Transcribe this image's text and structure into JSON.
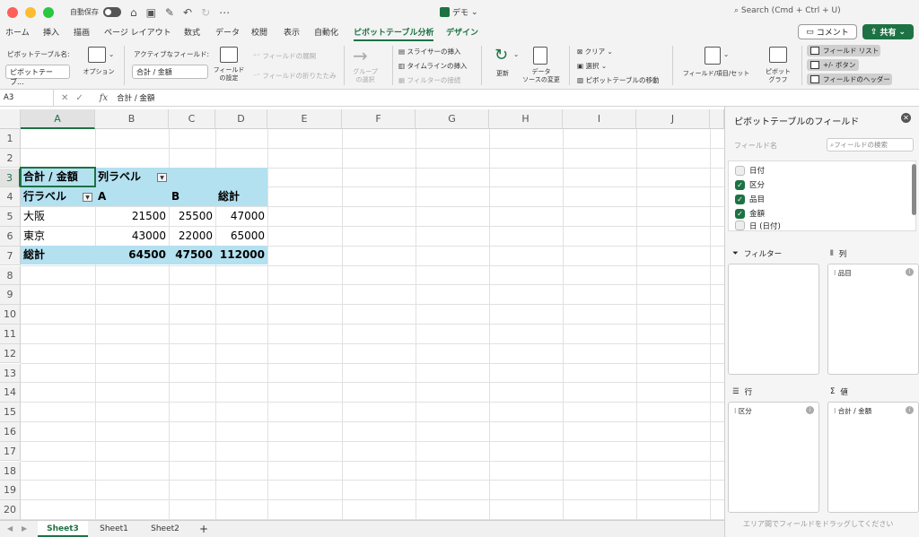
{
  "titlebar": {
    "autosave_label": "自動保存",
    "doc_title": "デモ",
    "search_placeholder": "Search (Cmd + Ctrl + U)"
  },
  "tabs": [
    {
      "label": "ホーム"
    },
    {
      "label": "挿入"
    },
    {
      "label": "描画"
    },
    {
      "label": "ページ レイアウト"
    },
    {
      "label": "数式"
    },
    {
      "label": "データ"
    },
    {
      "label": "校閲"
    },
    {
      "label": "表示"
    },
    {
      "label": "自動化"
    },
    {
      "label": "ピボットテーブル分析"
    },
    {
      "label": "デザイン"
    }
  ],
  "actions": {
    "comment": "コメント",
    "share": "共有"
  },
  "ribbon": {
    "pivot_name_label": "ピボットテーブル名:",
    "pivot_name_value": "ピボットテーブ...",
    "options": "オプション",
    "active_field_label": "アクティブなフィールド:",
    "active_field_value": "合計 / 金額",
    "field_settings_1": "フィールド",
    "field_settings_2": "の設定",
    "expand_field": "フィールドの展開",
    "collapse_field": "フィールドの折りたたみ",
    "group_1": "グループ",
    "group_2": "の選択",
    "insert_slicer": "スライサーの挿入",
    "insert_timeline": "タイムラインの挿入",
    "filter_connection": "フィルターの接続",
    "refresh": "更新",
    "datasource_1": "データ",
    "datasource_2": "ソースの変更",
    "clear": "クリア",
    "select": "選択",
    "move_pivot": "ピボットテーブルの移動",
    "fields_items": "フィールド/項目/セット",
    "pivot_chart_1": "ピボット",
    "pivot_chart_2": "グラフ",
    "field_list": "フィールド リスト",
    "plusminus": "+/- ボタン",
    "field_headers": "フィールドのヘッダー"
  },
  "formula_bar": {
    "cell": "A3",
    "fx": "fx",
    "value": "合計 / 金額"
  },
  "grid": {
    "columns": [
      "A",
      "B",
      "C",
      "D",
      "E",
      "F",
      "G",
      "H",
      "I",
      "J"
    ],
    "rows": [
      "1",
      "2",
      "3",
      "4",
      "5",
      "6",
      "7",
      "8",
      "9",
      "10",
      "11",
      "12",
      "13",
      "14",
      "15",
      "16",
      "17",
      "18",
      "19",
      "20"
    ]
  },
  "pivot": {
    "value_header": "合計 / 金額",
    "column_labels": "列ラベル",
    "row_labels": "行ラベル",
    "col_a": "A",
    "col_b": "B",
    "grand_total_col": "総計",
    "rows": [
      {
        "label": "大阪",
        "a": "21500",
        "b": "25500",
        "total": "47000"
      },
      {
        "label": "東京",
        "a": "43000",
        "b": "22000",
        "total": "65000"
      }
    ],
    "total_row": {
      "label": "総計",
      "a": "64500",
      "b": "47500",
      "total": "112000"
    }
  },
  "sheets": [
    {
      "label": "Sheet3"
    },
    {
      "label": "Sheet1"
    },
    {
      "label": "Sheet2"
    }
  ],
  "add_sheet": "+",
  "pane": {
    "title": "ピボットテーブルのフィールド",
    "field_name_label": "フィールド名",
    "search_placeholder": "フィールドの検索",
    "fields": [
      {
        "label": "日付",
        "checked": false
      },
      {
        "label": "区分",
        "checked": true
      },
      {
        "label": "品目",
        "checked": true
      },
      {
        "label": "金額",
        "checked": true
      },
      {
        "label": "日 (日付)",
        "checked": false
      }
    ],
    "filter_label": "フィルター",
    "columns_label": "列",
    "rows_label": "行",
    "values_label": "値",
    "columns_chip": "品目",
    "rows_chip": "区分",
    "values_chip": "合計 / 金額",
    "hint": "エリア間でフィールドをドラッグしてください"
  }
}
